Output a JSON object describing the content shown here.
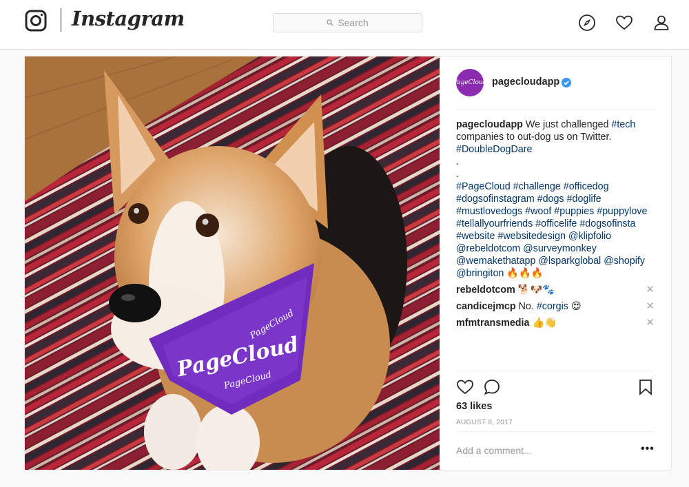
{
  "nav": {
    "wordmark": "Instagram",
    "search_placeholder": "Search",
    "icons": [
      "instagram-logo-icon",
      "search-icon",
      "compass-icon",
      "heart-icon",
      "profile-icon"
    ]
  },
  "post": {
    "author": "pagecloudapp",
    "avatar_text": "PageCloud",
    "verified": true,
    "caption": {
      "author": "pagecloudapp",
      "text_before": " We just challenged ",
      "tag1": "#tech",
      "text_after": " companies to out-dog us on Twitter.",
      "tag2": "#DoubleDogDare",
      "dot1": ".",
      "dot2": ".",
      "tags_block": "#PageCloud #challenge #officedog #dogsofinstagram #dogs #doglife #mustlovedogs #woof #puppies #puppylove #tellallyourfriends #officelife #dogsofinsta #website #websitedesign @klipfolio @rebeldotcom @surveymonkey @wemakethatapp @lsparkglobal @shopify @bringiton",
      "emoji": " 🔥🔥🔥"
    },
    "comments": [
      {
        "user": "rebeldotcom",
        "text": " 🐕🐶🐾"
      },
      {
        "user": "candicejmcp",
        "text": " No. ",
        "tag": "#corgis",
        "tail": " 😍"
      },
      {
        "user": "mfmtransmedia",
        "text": " 👍👋"
      }
    ],
    "likes": "63 likes",
    "date": "AUGUST 8, 2017",
    "add_comment_placeholder": "Add a comment...",
    "more_label": "•••",
    "bandana_text": "PageCloud",
    "colors": {
      "accent": "#8a2bb0",
      "link": "#003569",
      "verified": "#3897f0"
    }
  }
}
